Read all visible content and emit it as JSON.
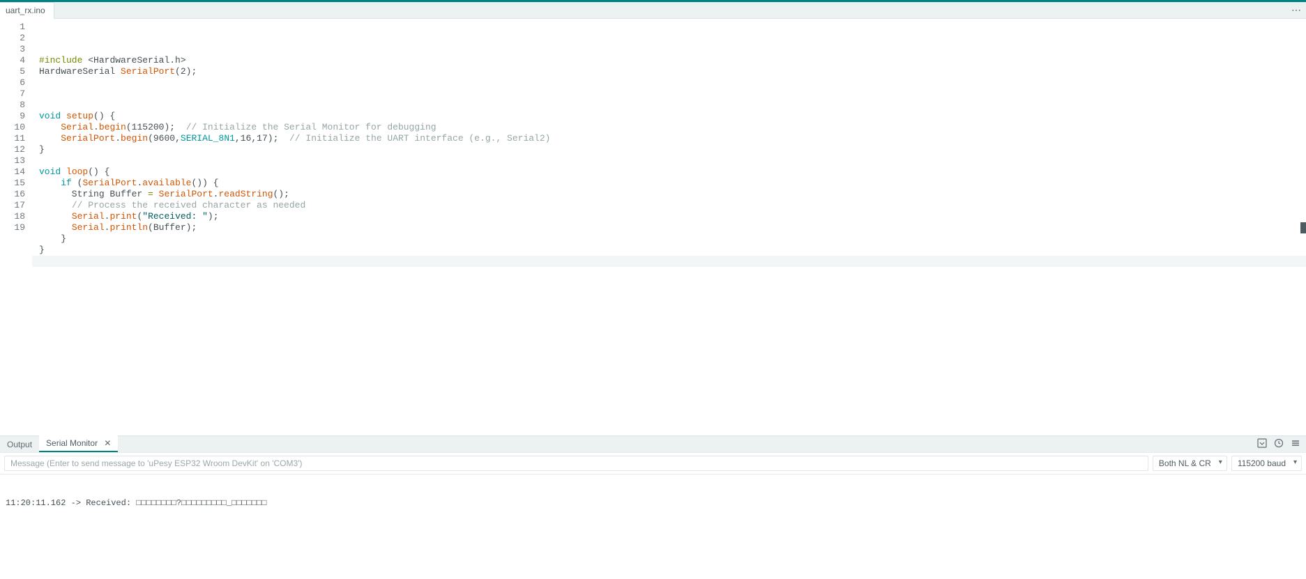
{
  "colors": {
    "accent": "#008184"
  },
  "tab": {
    "filename": "uart_rx.ino"
  },
  "code": {
    "lines": [
      {
        "n": 1,
        "tokens": [
          [
            "pp",
            "#include"
          ],
          [
            "plain",
            " "
          ],
          [
            "inc",
            "<HardwareSerial.h>"
          ]
        ]
      },
      {
        "n": 2,
        "tokens": [
          [
            "plain",
            "HardwareSerial "
          ],
          [
            "fn",
            "SerialPort"
          ],
          [
            "punct",
            "("
          ],
          [
            "num",
            "2"
          ],
          [
            "punct",
            ");"
          ]
        ]
      },
      {
        "n": 3,
        "tokens": []
      },
      {
        "n": 4,
        "tokens": []
      },
      {
        "n": 5,
        "tokens": []
      },
      {
        "n": 6,
        "tokens": [
          [
            "type",
            "void"
          ],
          [
            "plain",
            " "
          ],
          [
            "fn",
            "setup"
          ],
          [
            "punct",
            "() {"
          ]
        ]
      },
      {
        "n": 7,
        "tokens": [
          [
            "plain",
            "    "
          ],
          [
            "fn",
            "Serial"
          ],
          [
            "punct",
            "."
          ],
          [
            "fn",
            "begin"
          ],
          [
            "punct",
            "("
          ],
          [
            "num",
            "115200"
          ],
          [
            "punct",
            ");  "
          ],
          [
            "cmt",
            "// Initialize the Serial Monitor for debugging"
          ]
        ]
      },
      {
        "n": 8,
        "tokens": [
          [
            "plain",
            "    "
          ],
          [
            "fn",
            "SerialPort"
          ],
          [
            "punct",
            "."
          ],
          [
            "fn",
            "begin"
          ],
          [
            "punct",
            "("
          ],
          [
            "num",
            "9600"
          ],
          [
            "punct",
            ","
          ],
          [
            "type",
            "SERIAL_8N1"
          ],
          [
            "punct",
            ","
          ],
          [
            "num",
            "16"
          ],
          [
            "punct",
            ","
          ],
          [
            "num",
            "17"
          ],
          [
            "punct",
            ");  "
          ],
          [
            "cmt",
            "// Initialize the UART interface (e.g., Serial2)"
          ]
        ]
      },
      {
        "n": 9,
        "tokens": [
          [
            "punct",
            "}"
          ]
        ]
      },
      {
        "n": 10,
        "tokens": []
      },
      {
        "n": 11,
        "tokens": [
          [
            "type",
            "void"
          ],
          [
            "plain",
            " "
          ],
          [
            "fn",
            "loop"
          ],
          [
            "punct",
            "() {"
          ]
        ]
      },
      {
        "n": 12,
        "tokens": [
          [
            "plain",
            "    "
          ],
          [
            "type",
            "if"
          ],
          [
            "plain",
            " ("
          ],
          [
            "fn",
            "SerialPort"
          ],
          [
            "punct",
            "."
          ],
          [
            "fn",
            "available"
          ],
          [
            "punct",
            "()) {"
          ]
        ]
      },
      {
        "n": 13,
        "tokens": [
          [
            "plain",
            "      String Buffer "
          ],
          [
            "op",
            "="
          ],
          [
            "plain",
            " "
          ],
          [
            "fn",
            "SerialPort"
          ],
          [
            "punct",
            "."
          ],
          [
            "fn",
            "readString"
          ],
          [
            "punct",
            "();"
          ]
        ]
      },
      {
        "n": 14,
        "tokens": [
          [
            "plain",
            "      "
          ],
          [
            "cmt",
            "// Process the received character as needed"
          ]
        ]
      },
      {
        "n": 15,
        "tokens": [
          [
            "plain",
            "      "
          ],
          [
            "fn",
            "Serial"
          ],
          [
            "punct",
            "."
          ],
          [
            "fn",
            "print"
          ],
          [
            "punct",
            "("
          ],
          [
            "str",
            "\"Received: \""
          ],
          [
            "punct",
            ");"
          ]
        ]
      },
      {
        "n": 16,
        "tokens": [
          [
            "plain",
            "      "
          ],
          [
            "fn",
            "Serial"
          ],
          [
            "punct",
            "."
          ],
          [
            "fn",
            "println"
          ],
          [
            "punct",
            "(Buffer);"
          ]
        ]
      },
      {
        "n": 17,
        "tokens": [
          [
            "plain",
            "    }"
          ]
        ]
      },
      {
        "n": 18,
        "tokens": [
          [
            "punct",
            "}"
          ]
        ]
      },
      {
        "n": 19,
        "tokens": []
      }
    ],
    "current_line": 19
  },
  "panel": {
    "tabs": {
      "output": "Output",
      "serial_monitor": "Serial Monitor"
    },
    "send_placeholder": "Message (Enter to send message to 'uPesy ESP32 Wroom DevKit' on 'COM3')",
    "line_ending_selected": "Both NL & CR",
    "baud_selected": "115200 baud",
    "console_line": "11:20:11.162 -> Received: □□□□□□□□?□□□□□□□□□_□□□□□□□"
  }
}
